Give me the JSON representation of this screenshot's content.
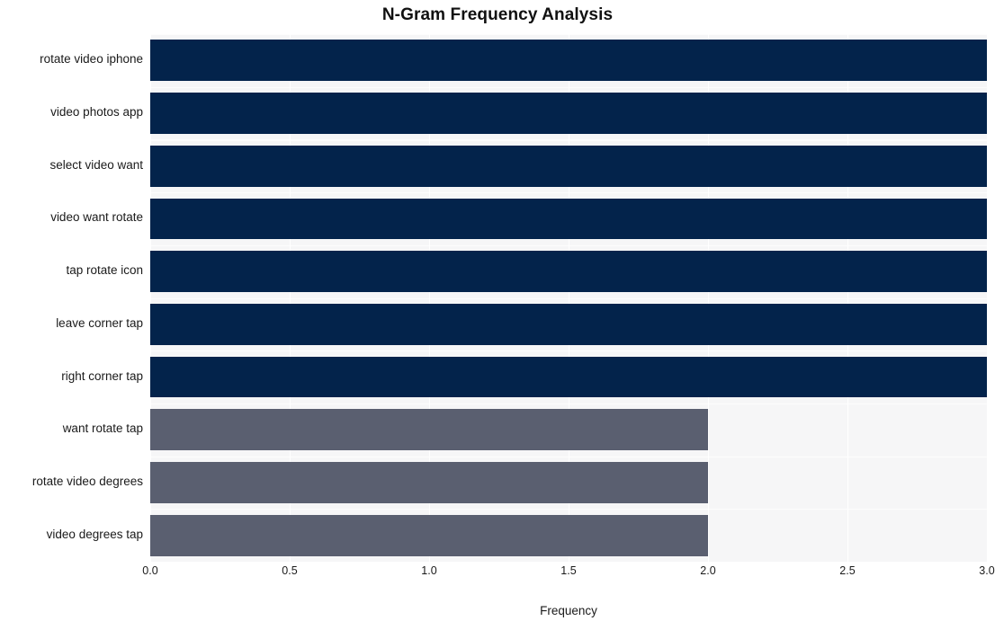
{
  "chart_data": {
    "type": "bar",
    "orientation": "horizontal",
    "title": "N-Gram Frequency Analysis",
    "xlabel": "Frequency",
    "ylabel": "",
    "categories": [
      "rotate video iphone",
      "video photos app",
      "select video want",
      "video want rotate",
      "tap rotate icon",
      "leave corner tap",
      "right corner tap",
      "want rotate tap",
      "rotate video degrees",
      "video degrees tap"
    ],
    "values": [
      3,
      3,
      3,
      3,
      3,
      3,
      3,
      2,
      2,
      2
    ],
    "bar_colors": [
      "#03234b",
      "#03234b",
      "#03234b",
      "#03234b",
      "#03234b",
      "#03234b",
      "#03234b",
      "#5a5f70",
      "#5a5f70",
      "#5a5f70"
    ],
    "xlim": [
      0.0,
      3.0
    ],
    "xticks": [
      "0.0",
      "0.5",
      "1.0",
      "1.5",
      "2.0",
      "2.5",
      "3.0"
    ],
    "xtick_values": [
      0.0,
      0.5,
      1.0,
      1.5,
      2.0,
      2.5,
      3.0
    ],
    "grid": true,
    "grid_color": "#ffffff",
    "plot_background": "#f6f6f7",
    "figure_background": "#ffffff",
    "legend": null
  },
  "figure": {
    "title": "N-Gram Frequency Analysis"
  }
}
